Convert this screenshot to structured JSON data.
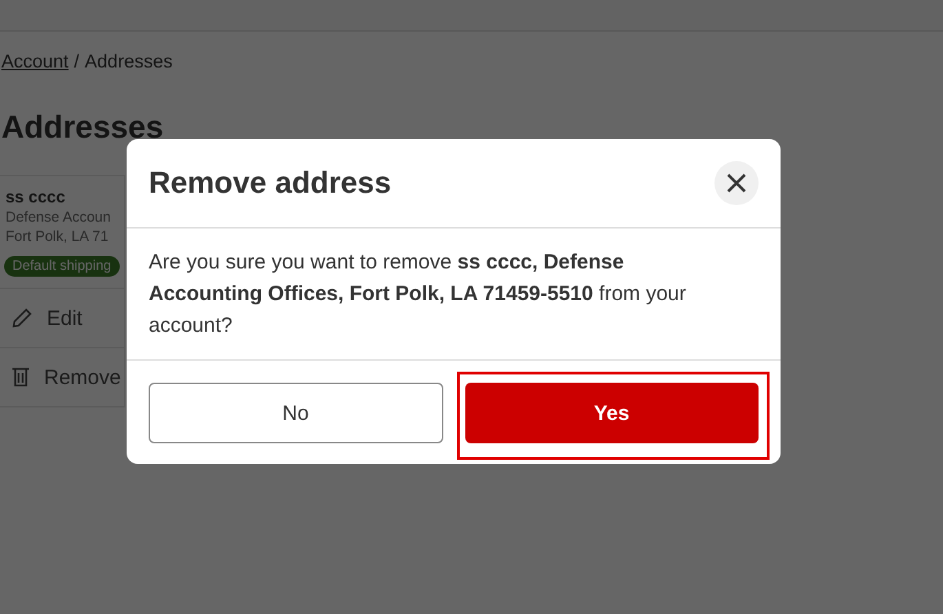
{
  "breadcrumb": [
    {
      "label": "Account",
      "kind": "link"
    },
    {
      "label": "/",
      "kind": "separator"
    },
    {
      "label": "Addresses",
      "kind": "current"
    }
  ],
  "heading": "Addresses",
  "address_card": {
    "name": "ss cccc",
    "lines": [
      "Defense Accoun",
      "Fort Polk, LA 71"
    ],
    "badge": "Default shipping",
    "actions": [
      {
        "label": "Edit",
        "kind": "edit"
      },
      {
        "label": "Remove",
        "kind": "remove"
      }
    ]
  },
  "dialog": {
    "title": "Remove address",
    "message": "Are you sure you want to remove **ss cccc, Defense Accounting Offices, Fort Polk, LA 71459-5510** from your account?",
    "buttons": [
      {
        "label": "No",
        "kind": "secondary",
        "highlighted": false
      },
      {
        "label": "Yes",
        "kind": "primary",
        "highlighted": true
      }
    ]
  }
}
